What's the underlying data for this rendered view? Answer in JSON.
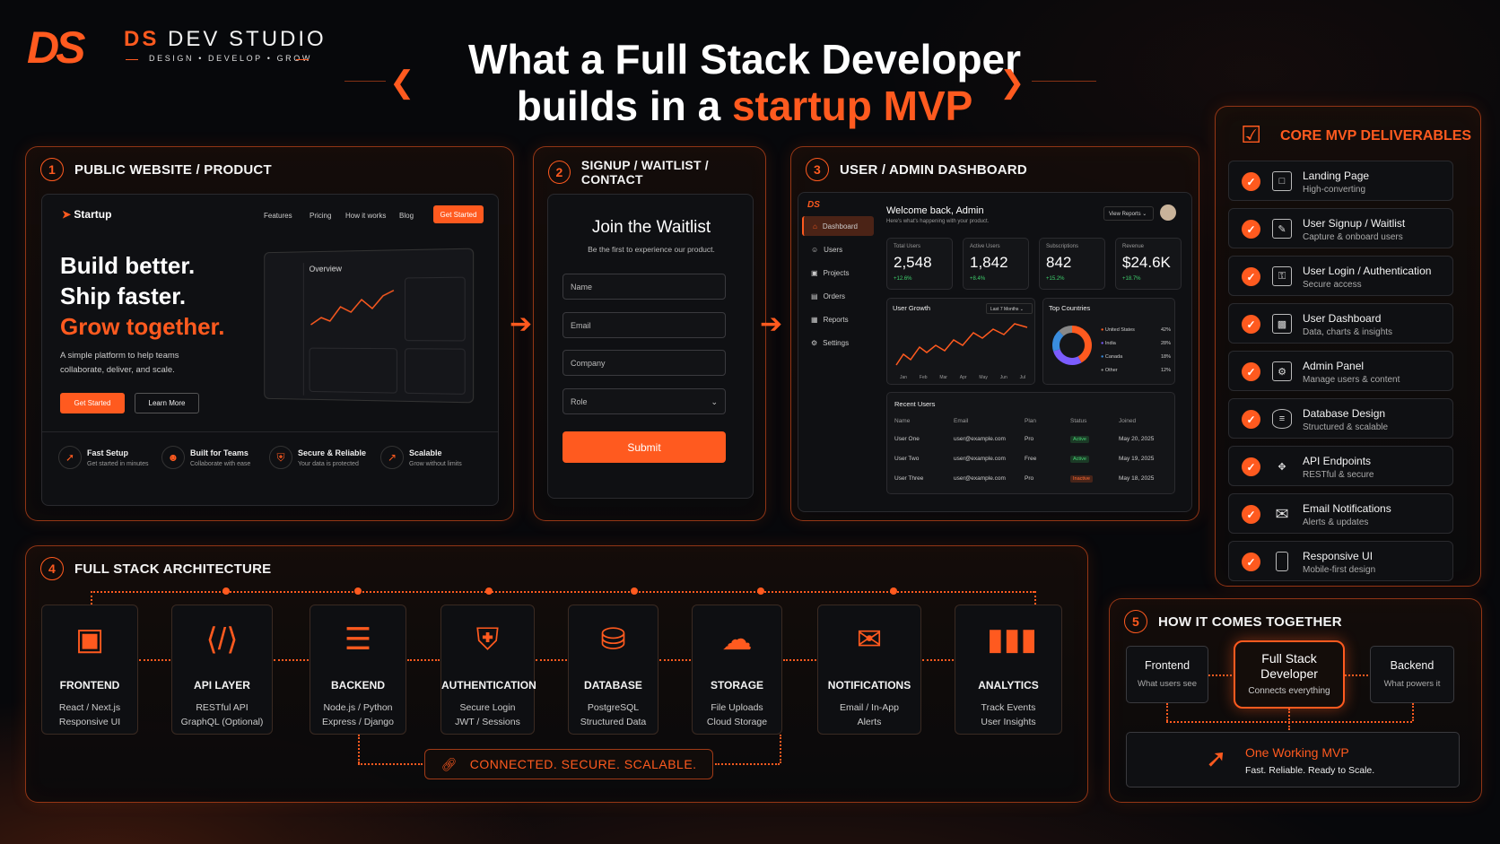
{
  "brand": {
    "logo": "DS",
    "name_1": "DS",
    "name_2": "DEV STUDIO",
    "tagline": "DESIGN • DEVELOP • GROW"
  },
  "title": {
    "line1": "What a Full Stack Developer",
    "line2_prefix": "builds in a ",
    "line2_highlight": "startup MVP"
  },
  "colors": {
    "accent": "#ff5a1f",
    "background": "#07080b",
    "success": "#3ecf6c"
  },
  "section1": {
    "num": "1",
    "title": "PUBLIC WEBSITE / PRODUCT",
    "site": {
      "logo": "Startup",
      "nav": [
        "Features",
        "Pricing",
        "How it works",
        "Blog"
      ],
      "cta": "Get Started",
      "hero1": "Build better.",
      "hero2": "Ship faster.",
      "hero3": "Grow together.",
      "sub1": "A simple platform to help teams",
      "sub2": "collaborate, deliver, and scale.",
      "btn_primary": "Get Started",
      "btn_secondary": "Learn More",
      "preview_title": "Overview",
      "features": [
        {
          "title": "Fast Setup",
          "sub": "Get started in minutes",
          "icon": "rocket-icon"
        },
        {
          "title": "Built for Teams",
          "sub": "Collaborate with ease",
          "icon": "team-icon"
        },
        {
          "title": "Secure & Reliable",
          "sub": "Your data is protected",
          "icon": "shield-icon"
        },
        {
          "title": "Scalable",
          "sub": "Grow without limits",
          "icon": "growth-icon"
        }
      ]
    }
  },
  "section2": {
    "num": "2",
    "title": "SIGNUP / WAITLIST / CONTACT",
    "form": {
      "title": "Join the Waitlist",
      "subtitle": "Be the first to experience our product.",
      "fields": [
        "Name",
        "Email",
        "Company",
        "Role"
      ],
      "submit": "Submit"
    }
  },
  "section3": {
    "num": "3",
    "title": "USER / ADMIN DASHBOARD",
    "dash": {
      "welcome": "Welcome back, Admin",
      "welcome_sub": "Here's what's happening with your product.",
      "view_reports": "View Reports",
      "nav": [
        "Dashboard",
        "Users",
        "Projects",
        "Orders",
        "Reports",
        "Settings"
      ],
      "stats": [
        {
          "label": "Total Users",
          "value": "2,548",
          "delta": "+12.6%"
        },
        {
          "label": "Active Users",
          "value": "1,842",
          "delta": "+8.4%"
        },
        {
          "label": "Subscriptions",
          "value": "842",
          "delta": "+15.2%"
        },
        {
          "label": "Revenue",
          "value": "$24.6K",
          "delta": "+18.7%"
        }
      ],
      "growth_title": "User Growth",
      "growth_range": "Last 7 Months",
      "growth_months": [
        "Jan",
        "Feb",
        "Mar",
        "Apr",
        "May",
        "Jun",
        "Jul"
      ],
      "countries_title": "Top Countries",
      "countries": [
        {
          "name": "United States",
          "pct": "42%",
          "color": "#ff5a1f"
        },
        {
          "name": "India",
          "pct": "28%",
          "color": "#7b5cff"
        },
        {
          "name": "Canada",
          "pct": "18%",
          "color": "#3a8dde"
        },
        {
          "name": "Other",
          "pct": "12%",
          "color": "#888888"
        }
      ],
      "recent_title": "Recent Users",
      "table_headers": [
        "Name",
        "Email",
        "Plan",
        "Status",
        "Joined"
      ],
      "rows": [
        [
          "User One",
          "user@example.com",
          "Pro",
          "Active",
          "May 20, 2025"
        ],
        [
          "User Two",
          "user@example.com",
          "Free",
          "Active",
          "May 19, 2025"
        ],
        [
          "User Three",
          "user@example.com",
          "Pro",
          "Inactive",
          "May 18, 2025"
        ]
      ]
    }
  },
  "deliverables": {
    "title": "CORE MVP DELIVERABLES",
    "items": [
      {
        "title": "Landing Page",
        "sub": "High-converting",
        "icon": "landing-page-icon"
      },
      {
        "title": "User Signup / Waitlist",
        "sub": "Capture & onboard users",
        "icon": "signup-icon"
      },
      {
        "title": "User Login / Authentication",
        "sub": "Secure access",
        "icon": "login-icon"
      },
      {
        "title": "User Dashboard",
        "sub": "Data, charts & insights",
        "icon": "dashboard-icon"
      },
      {
        "title": "Admin Panel",
        "sub": "Manage users & content",
        "icon": "admin-icon"
      },
      {
        "title": "Database Design",
        "sub": "Structured & scalable",
        "icon": "database-icon"
      },
      {
        "title": "API Endpoints",
        "sub": "RESTful & secure",
        "icon": "api-icon"
      },
      {
        "title": "Email Notifications",
        "sub": "Alerts & updates",
        "icon": "mail-icon"
      },
      {
        "title": "Responsive UI",
        "sub": "Mobile-first design",
        "icon": "mobile-icon"
      }
    ]
  },
  "section4": {
    "num": "4",
    "title": "FULL STACK ARCHITECTURE",
    "cards": [
      {
        "title": "FRONTEND",
        "l1": "React / Next.js",
        "l2": "Responsive UI",
        "icon": "code-window-icon"
      },
      {
        "title": "API LAYER",
        "l1": "RESTful API",
        "l2": "GraphQL (Optional)",
        "icon": "api-code-icon"
      },
      {
        "title": "BACKEND",
        "l1": "Node.js / Python",
        "l2": "Express / Django",
        "icon": "server-icon"
      },
      {
        "title": "AUTHENTICATION",
        "l1": "Secure Login",
        "l2": "JWT / Sessions",
        "icon": "lock-shield-icon"
      },
      {
        "title": "DATABASE",
        "l1": "PostgreSQL",
        "l2": "Structured Data",
        "icon": "database-icon"
      },
      {
        "title": "STORAGE",
        "l1": "File Uploads",
        "l2": "Cloud Storage",
        "icon": "cloud-icon"
      },
      {
        "title": "NOTIFICATIONS",
        "l1": "Email / In-App",
        "l2": "Alerts",
        "icon": "envelope-icon"
      },
      {
        "title": "ANALYTICS",
        "l1": "Track Events",
        "l2": "User Insights",
        "icon": "bar-chart-icon"
      }
    ],
    "footer": "CONNECTED. SECURE. SCALABLE."
  },
  "section5": {
    "num": "5",
    "title": "HOW IT COMES TOGETHER",
    "frontend_t": "Frontend",
    "frontend_s": "What users see",
    "center_t1": "Full Stack",
    "center_t2": "Developer",
    "center_s": "Connects everything",
    "backend_t": "Backend",
    "backend_s": "What powers it",
    "result_t": "One Working MVP",
    "result_s": "Fast. Reliable. Ready to Scale."
  }
}
